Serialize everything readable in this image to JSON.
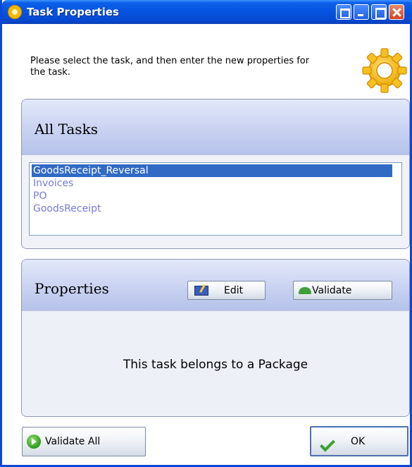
{
  "window": {
    "title": "Task Properties",
    "icon": "task-properties-gear-icon"
  },
  "instruction": "Please select the task, and then enter the new properties for the task.",
  "tasks": {
    "heading": "All Tasks",
    "items": [
      "GoodsReceipt_Reversal",
      "Invoices",
      "PO",
      "GoodsReceipt"
    ],
    "selected_index": 0
  },
  "properties": {
    "heading": "Properties",
    "edit_label": "Edit",
    "validate_label": "Validate",
    "message": "This task belongs to a Package"
  },
  "footer": {
    "validate_all_label": "Validate All",
    "ok_label": "OK"
  },
  "colors": {
    "titlebar": "#0653e0",
    "selection": "#316ac5",
    "list_text": "#7878dc"
  }
}
